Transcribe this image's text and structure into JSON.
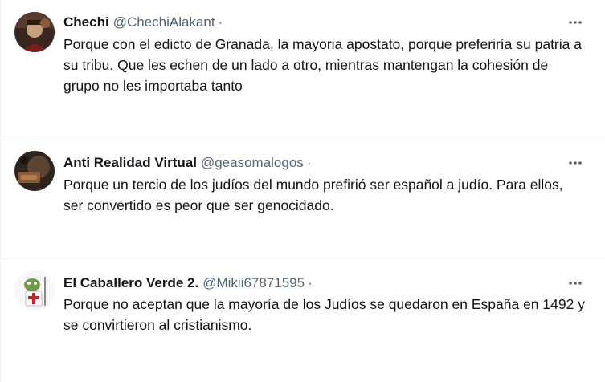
{
  "tweets": [
    {
      "display_name": "Chechi",
      "handle": "@ChechiAlakant",
      "separator": "·",
      "text": "Porque con el edicto de Granada, la mayoria apostato, porque preferiría su patria a su tribu. Que les echen de un lado a otro, mientras mantengan la cohesión de grupo no les importaba tanto",
      "more_icon": "more-horizontal-icon"
    },
    {
      "display_name": "Anti Realidad Virtual",
      "handle": "@geasomalogos",
      "separator": "·",
      "text": "Porque un tercio de los judíos del mundo prefirió ser español a judío. Para ellos, ser convertido es peor que ser genocidado.",
      "more_icon": "more-horizontal-icon"
    },
    {
      "display_name": "El Caballero Verde 2.",
      "handle": "@Mikii67871595",
      "separator": "·",
      "text": "Porque no aceptan que la mayoría de los Judíos se quedaron en España en 1492 y se convirtieron al cristianismo.",
      "more_icon": "more-horizontal-icon"
    }
  ],
  "colors": {
    "text_primary": "#0f1419",
    "text_secondary": "#536471",
    "divider": "#eff3f4"
  }
}
